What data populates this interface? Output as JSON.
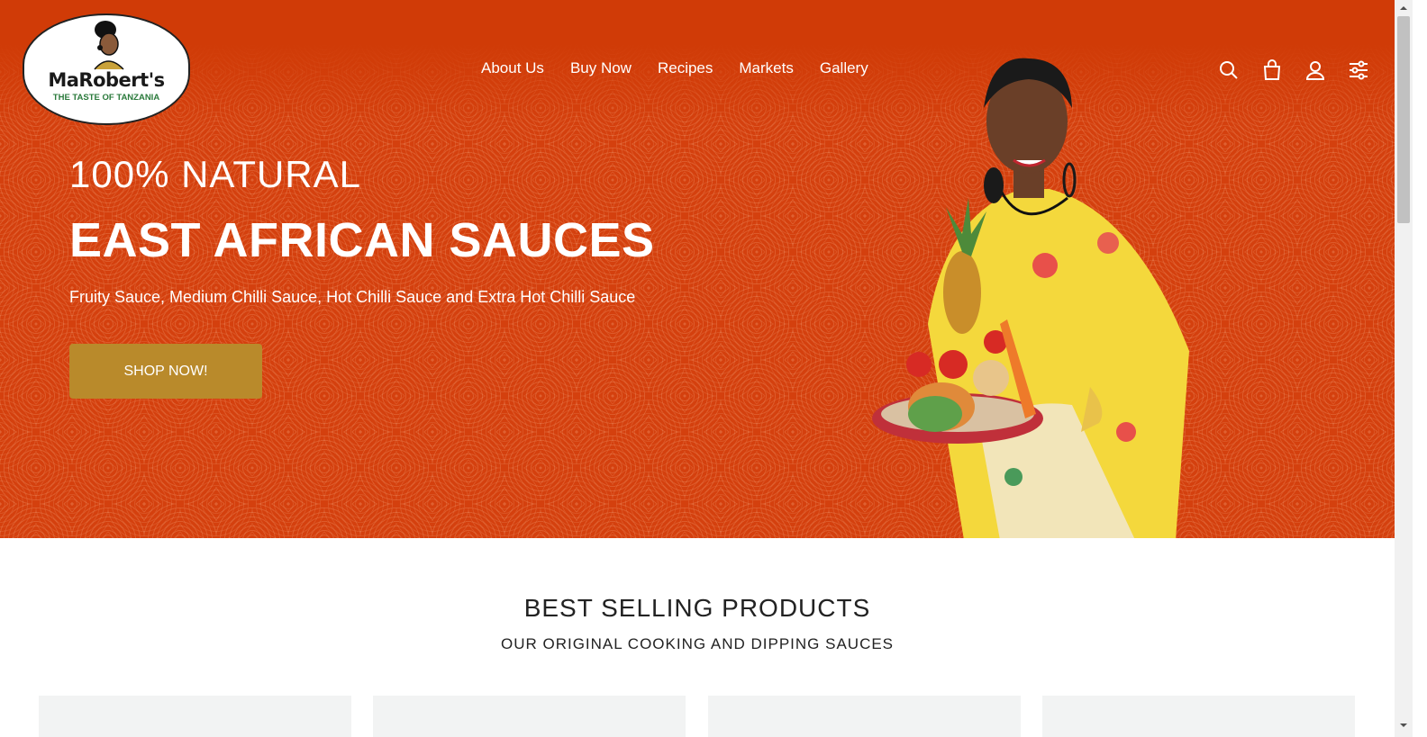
{
  "brand": {
    "name": "MaRobert's",
    "tagline": "THE TASTE OF TANZANIA"
  },
  "nav": {
    "items": [
      "About Us",
      "Buy Now",
      "Recipes",
      "Markets",
      "Gallery"
    ]
  },
  "header_icons": [
    "search-icon",
    "cart-icon",
    "account-icon",
    "filter-settings-icon"
  ],
  "hero": {
    "line1": "100% NATURAL",
    "line2": "EAST AFRICAN SAUCES",
    "subline": "Fruity Sauce, Medium Chilli Sauce, Hot Chilli Sauce and Extra Hot Chilli Sauce",
    "cta": "SHOP NOW!"
  },
  "section": {
    "title": "BEST SELLING PRODUCTS",
    "subtitle": "OUR ORIGINAL COOKING AND DIPPING SAUCES"
  },
  "colors": {
    "hero_bg": "#d4400e",
    "cta_bg": "#b98a2b",
    "card_bg": "#f2f3f3"
  }
}
